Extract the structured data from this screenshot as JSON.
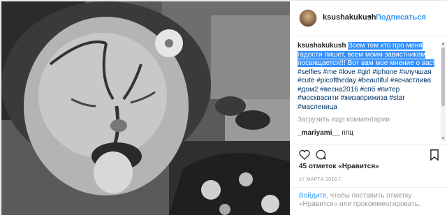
{
  "header": {
    "username": "ksushakukush",
    "dot": "•",
    "follow_label": "Подписаться"
  },
  "caption": {
    "username": "ksushakukush",
    "highlighted_text": "Всем тем кто про меня гадости пишет, всем моим завистникам посвящается!!! Вот вам мое мнение о вас!",
    "hashtags": "#selfies #me #love #girl #iphone #ялучшая #cute #picoftheday #beautiful #ясчастлива #дом2 #весна2016 #спб #питер #москвасити #жизаприжиза #star #масленица"
  },
  "load_more": "Загрузить еще комментарии",
  "comment": {
    "username": "_mariyami__",
    "text": "ппц"
  },
  "likes": "45 отметок «Нравится»",
  "date": "17 МАРТА 2016 Г.",
  "footer": {
    "login_link": "Войдите",
    "text": ", чтобы поставить отметку «Нравится» или прокомментировать."
  },
  "icons": {
    "like": "heart-icon",
    "comment": "comment-icon",
    "save": "bookmark-icon",
    "options": "more-icon"
  }
}
